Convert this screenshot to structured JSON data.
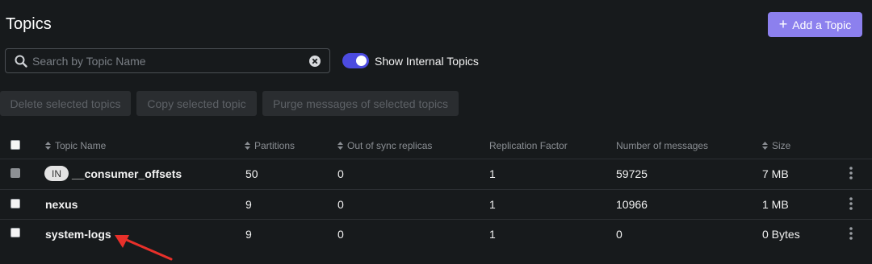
{
  "page": {
    "title": "Topics"
  },
  "actions": {
    "add_topic_label": "Add a Topic"
  },
  "search": {
    "placeholder": "Search by Topic Name",
    "value": ""
  },
  "toggle": {
    "label": "Show Internal Topics",
    "on": true
  },
  "bulk": {
    "delete_label": "Delete selected topics",
    "copy_label": "Copy selected topic",
    "purge_label": "Purge messages of selected topics"
  },
  "table": {
    "columns": {
      "name": "Topic Name",
      "partitions": "Partitions",
      "out_of_sync": "Out of sync replicas",
      "replication": "Replication Factor",
      "messages": "Number of messages",
      "size": "Size"
    },
    "rows": [
      {
        "internal_badge": "IN",
        "name": "__consumer_offsets",
        "partitions": "50",
        "out_of_sync": "0",
        "replication": "1",
        "messages": "59725",
        "size": "7 MB"
      },
      {
        "name": "nexus",
        "partitions": "9",
        "out_of_sync": "0",
        "replication": "1",
        "messages": "10966",
        "size": "1 MB"
      },
      {
        "name": "system-logs",
        "partitions": "9",
        "out_of_sync": "0",
        "replication": "1",
        "messages": "0",
        "size": "0 Bytes"
      }
    ]
  },
  "colors": {
    "accent": "#8c80ee",
    "toggle": "#4c4be0",
    "background": "#171a1c",
    "annotation_arrow": "#e8302a"
  },
  "icons": {
    "search": "search-icon",
    "clear": "clear-icon",
    "sort": "sort-icon",
    "menu": "kebab-menu-icon",
    "add": "plus-icon"
  }
}
